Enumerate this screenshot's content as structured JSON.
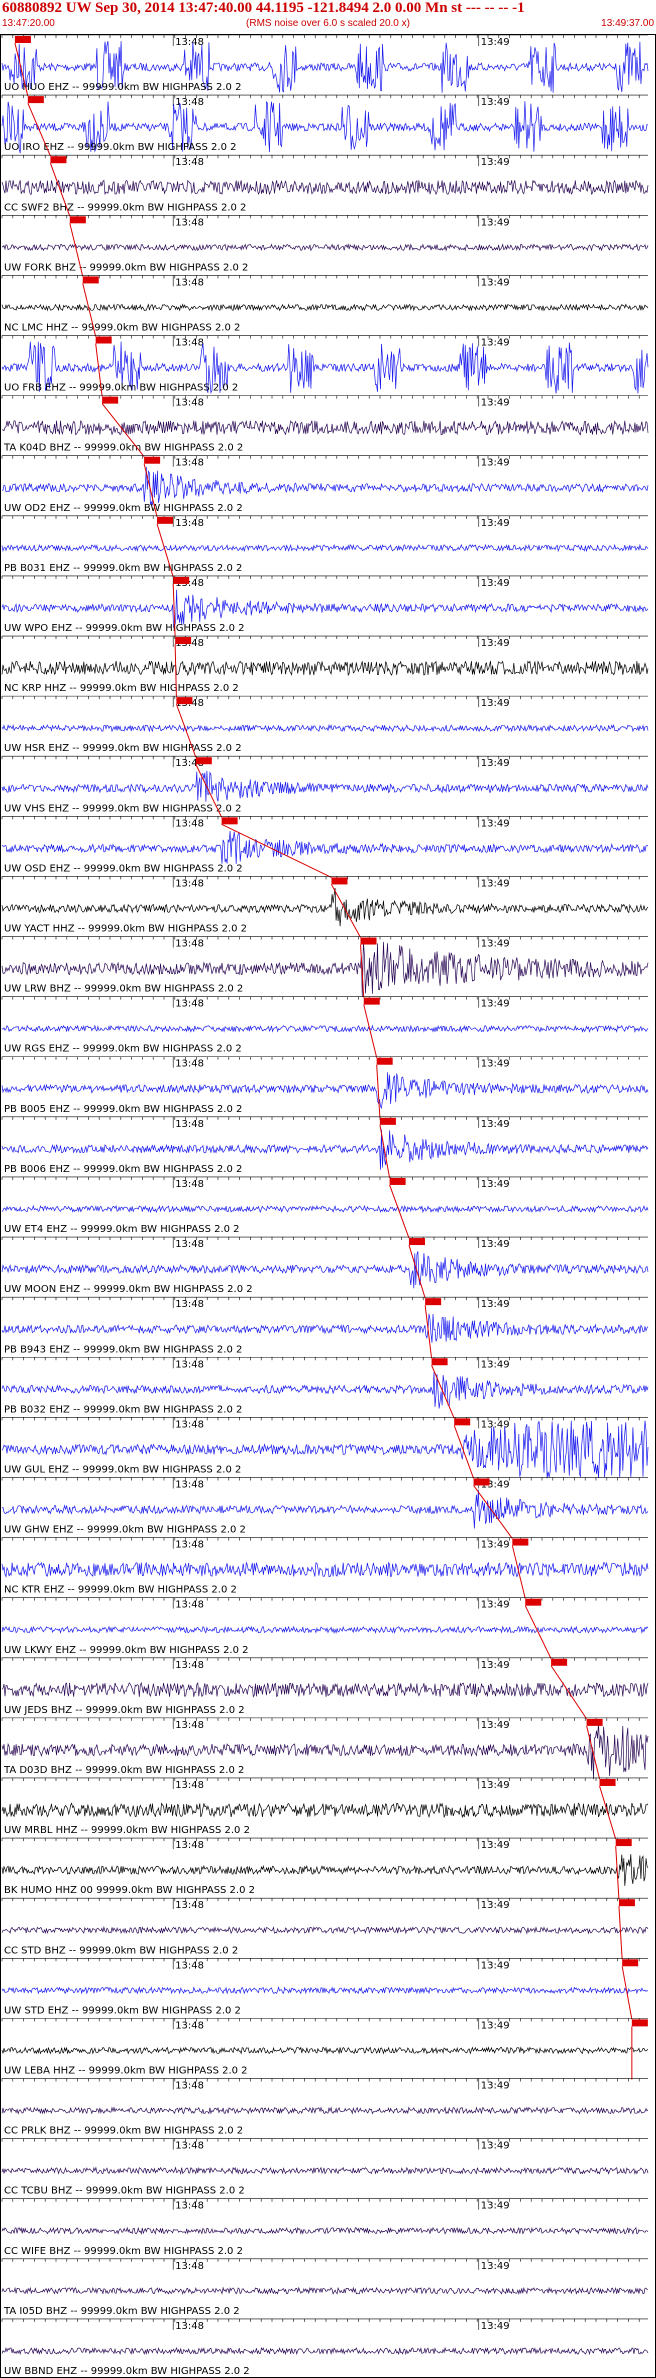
{
  "header": {
    "title": "60880892 UW Sep 30, 2014 13:47:40.00   44.1195 -121.8494  2.0 0.00 Mn st --- -- --  -1",
    "start_time": "13:47:20.00",
    "note": "(RMS noise over 6.0 s scaled 20.0 x)",
    "end_time": "13:49:37.00"
  },
  "colors": {
    "blue": "#1a1aee",
    "dark": "#2a0a55",
    "black": "#000000",
    "pick": "#dd0000"
  },
  "chart_data": {
    "type": "seismogram",
    "x_range": [
      "13:47:20.00",
      "13:49:37.00"
    ],
    "time_marks": [
      "13:48",
      "13:49"
    ],
    "channels": [
      {
        "label": "UO HUO EHZ -- 99999.0km BW  HIGHPASS  2.0  2",
        "color": "blue",
        "activity": "bursts",
        "pick": 0.02
      },
      {
        "label": "UO IRO EHZ -- 99999.0km BW  HIGHPASS  2.0  2",
        "color": "blue",
        "activity": "bursts",
        "pick": 0.04
      },
      {
        "label": "CC SWF2 BHZ -- 99999.0km BW  HIGHPASS  2.0  2",
        "color": "dark",
        "activity": "noise",
        "pick": 0.075
      },
      {
        "label": "UW FORK BHZ -- 99999.0km BW  HIGHPASS  2.0  2",
        "color": "dark",
        "activity": "quiet",
        "pick": 0.105
      },
      {
        "label": "NC LMC HHZ -- 99999.0km BW  HIGHPASS  2.0  2",
        "color": "black",
        "activity": "quiet",
        "pick": 0.125
      },
      {
        "label": "UO FRB EHZ -- 99999.0km BW  HIGHPASS  2.0  2",
        "color": "blue",
        "activity": "bursts",
        "pick": 0.145
      },
      {
        "label": "TA K04D BHZ -- 99999.0km BW  HIGHPASS  2.0  2",
        "color": "dark",
        "activity": "noise",
        "pick": 0.155
      },
      {
        "label": "UW OD2 EHZ -- 99999.0km BW  HIGHPASS  2.0  2",
        "color": "blue",
        "activity": "event",
        "pick": 0.22
      },
      {
        "label": "PB B031 EHZ -- 99999.0km BW  HIGHPASS  2.0  2",
        "color": "blue",
        "activity": "quiet",
        "pick": 0.24
      },
      {
        "label": "UW WPO EHZ -- 99999.0km BW  HIGHPASS  2.0  2",
        "color": "blue",
        "activity": "event",
        "pick": 0.265
      },
      {
        "label": "NC KRP HHZ -- 99999.0km BW  HIGHPASS  2.0  2",
        "color": "black",
        "activity": "noise",
        "pick": 0.268
      },
      {
        "label": "UW HSR EHZ -- 99999.0km BW  HIGHPASS  2.0  2",
        "color": "blue",
        "activity": "quiet",
        "pick": 0.27
      },
      {
        "label": "UW VHS EHZ -- 99999.0km BW  HIGHPASS  2.0  2",
        "color": "blue",
        "activity": "event",
        "pick": 0.3
      },
      {
        "label": "UW OSD EHZ -- 99999.0km BW  HIGHPASS  2.0  2",
        "color": "blue",
        "activity": "event",
        "pick": 0.34
      },
      {
        "label": "UW YACT HHZ -- 99999.0km BW  HIGHPASS  2.0  2",
        "color": "black",
        "activity": "event",
        "pick": 0.51
      },
      {
        "label": "UW LRW BHZ -- 99999.0km BW  HIGHPASS  2.0  2",
        "color": "dark",
        "activity": "strong",
        "pick": 0.555
      },
      {
        "label": "UW RGS EHZ -- 99999.0km BW  HIGHPASS  2.0  2",
        "color": "blue",
        "activity": "quiet",
        "pick": 0.56
      },
      {
        "label": "PB B005 EHZ -- 99999.0km BW  HIGHPASS  2.0  2",
        "color": "blue",
        "activity": "event",
        "pick": 0.58
      },
      {
        "label": "PB B006 EHZ -- 99999.0km BW  HIGHPASS  2.0  2",
        "color": "blue",
        "activity": "event",
        "pick": 0.585
      },
      {
        "label": "UW ET4 EHZ -- 99999.0km BW  HIGHPASS  2.0  2",
        "color": "blue",
        "activity": "quiet",
        "pick": 0.6
      },
      {
        "label": "UW MOON EHZ -- 99999.0km BW  HIGHPASS  2.0  2",
        "color": "blue",
        "activity": "event",
        "pick": 0.63
      },
      {
        "label": "PB B943 EHZ -- 99999.0km BW  HIGHPASS  2.0  2",
        "color": "blue",
        "activity": "event",
        "pick": 0.655
      },
      {
        "label": "PB B032 EHZ -- 99999.0km BW  HIGHPASS  2.0  2",
        "color": "blue",
        "activity": "event",
        "pick": 0.665
      },
      {
        "label": "UW GUL EHZ -- 99999.0km BW  HIGHPASS  2.0  2",
        "color": "blue",
        "activity": "saturated",
        "pick": 0.7
      },
      {
        "label": "UW GHW EHZ -- 99999.0km BW  HIGHPASS  2.0  2",
        "color": "blue",
        "activity": "event",
        "pick": 0.73
      },
      {
        "label": "NC KTR EHZ -- 99999.0km BW  HIGHPASS  2.0  2",
        "color": "blue",
        "activity": "noise",
        "pick": 0.79
      },
      {
        "label": "UW LKWY EHZ -- 99999.0km BW  HIGHPASS  2.0  2",
        "color": "blue",
        "activity": "quiet",
        "pick": 0.81
      },
      {
        "label": "UW JEDS BHZ -- 99999.0km BW  HIGHPASS  2.0  2",
        "color": "dark",
        "activity": "noise",
        "pick": 0.85
      },
      {
        "label": "TA D03D BHZ -- 99999.0km BW  HIGHPASS  2.0  2",
        "color": "dark",
        "activity": "strong",
        "pick": 0.905
      },
      {
        "label": "UW MRBL HHZ -- 99999.0km BW  HIGHPASS  2.0  2",
        "color": "black",
        "activity": "noise",
        "pick": 0.925
      },
      {
        "label": "BK HUMO HHZ 00 99999.0km BW  HIGHPASS  2.0  2",
        "color": "black",
        "activity": "event",
        "pick": 0.95
      },
      {
        "label": "CC STD BHZ -- 99999.0km BW  HIGHPASS  2.0  2",
        "color": "dark",
        "activity": "quiet",
        "pick": 0.955
      },
      {
        "label": "UW STD EHZ -- 99999.0km BW  HIGHPASS  2.0  2",
        "color": "blue",
        "activity": "quiet",
        "pick": 0.96
      },
      {
        "label": "UW LEBA HHZ -- 99999.0km BW  HIGHPASS  2.0  2",
        "color": "black",
        "activity": "quiet",
        "pick": 0.975
      },
      {
        "label": "CC PRLK BHZ -- 99999.0km BW  HIGHPASS  2.0  2",
        "color": "dark",
        "activity": "quiet",
        "pick": null
      },
      {
        "label": "CC TCBU BHZ -- 99999.0km BW  HIGHPASS  2.0  2",
        "color": "dark",
        "activity": "quiet",
        "pick": null
      },
      {
        "label": "CC WIFE BHZ -- 99999.0km BW  HIGHPASS  2.0  2",
        "color": "dark",
        "activity": "quiet",
        "pick": null
      },
      {
        "label": "TA I05D BHZ -- 99999.0km BW  HIGHPASS  2.0  2",
        "color": "dark",
        "activity": "quiet",
        "pick": null
      },
      {
        "label": "UW BBND EHZ -- 99999.0km BW  HIGHPASS  2.0  2",
        "color": "dark",
        "activity": "quiet",
        "pick": null
      }
    ]
  }
}
